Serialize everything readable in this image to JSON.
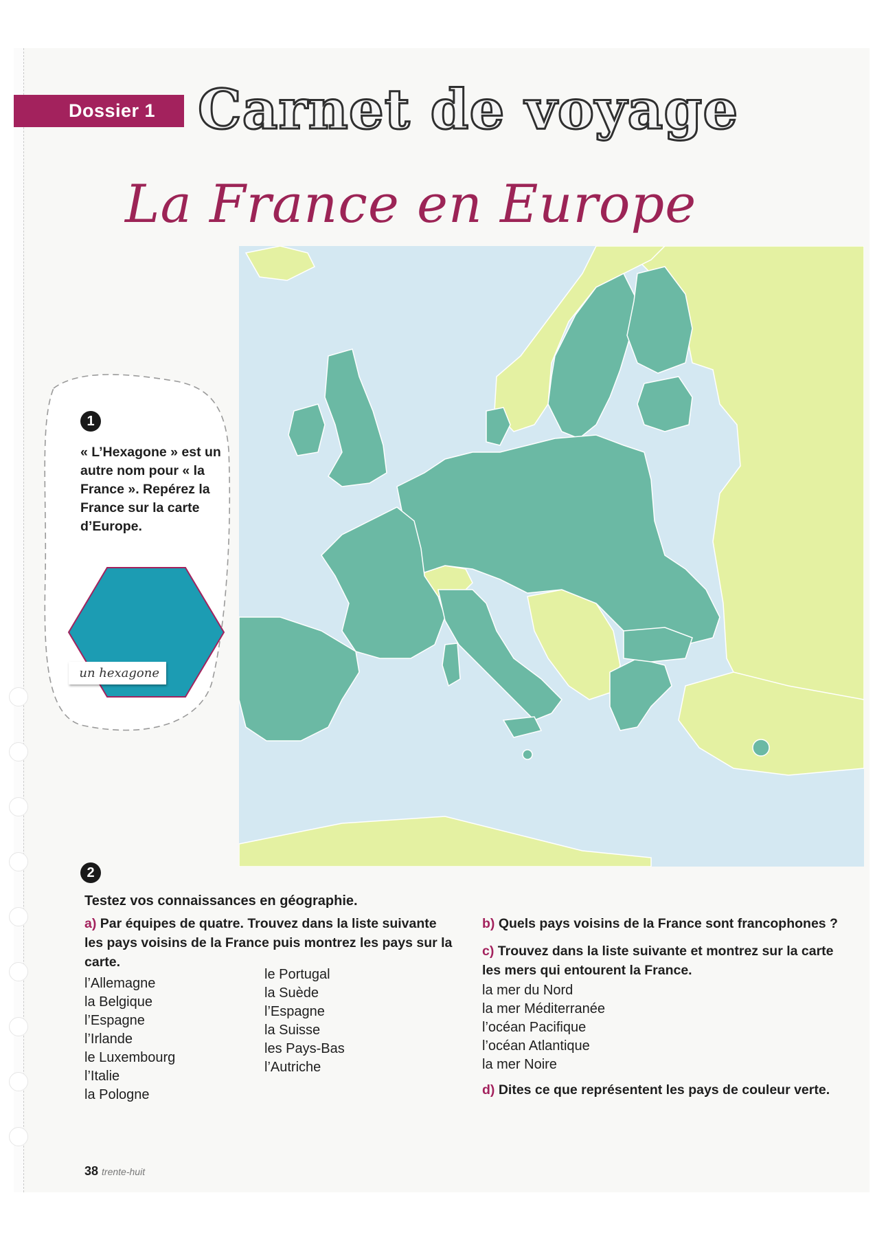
{
  "header": {
    "dossier_label": "Dossier 1",
    "title": "Carnet de voyage",
    "subtitle": "La France en Europe"
  },
  "exercise1": {
    "number": "1",
    "text": "« L’Hexagone » est un autre nom pour « la France ». Repérez la France sur la carte d’Europe.",
    "hexagon_label": "un hexagone"
  },
  "map": {
    "sea_color": "#d4e8f2",
    "eu_color": "#6bb9a4",
    "non_eu_color": "#e4f1a2",
    "border_color": "#ffffff"
  },
  "exercise2": {
    "number": "2",
    "intro": "Testez vos connaissances en géographie.",
    "qa": {
      "letter": "a)",
      "text": "Par équipes de quatre. Trouvez dans la liste suivante les pays voisins de la France puis montrez les pays sur la carte."
    },
    "list_a1": [
      "l’Allemagne",
      "la Belgique",
      "l’Espagne",
      "l’Irlande",
      "le Luxembourg",
      "l’Italie",
      "la Pologne"
    ],
    "list_a2": [
      "le Portugal",
      "la Suède",
      "l’Espagne",
      "la Suisse",
      "les Pays-Bas",
      "l’Autriche"
    ],
    "qb": {
      "letter": "b)",
      "text": "Quels pays voisins de la France sont francophones ?"
    },
    "qc": {
      "letter": "c)",
      "text": "Trouvez dans la liste suivante et montrez sur la carte les mers qui entourent la France."
    },
    "list_c": [
      "la mer du Nord",
      "la mer Méditerranée",
      "l’océan Pacifique",
      "l’océan Atlantique",
      "la mer Noire"
    ],
    "qd": {
      "letter": "d)",
      "text": "Dites ce que représentent les pays de couleur verte."
    }
  },
  "footer": {
    "page_number": "38",
    "page_word": "trente-huit"
  }
}
